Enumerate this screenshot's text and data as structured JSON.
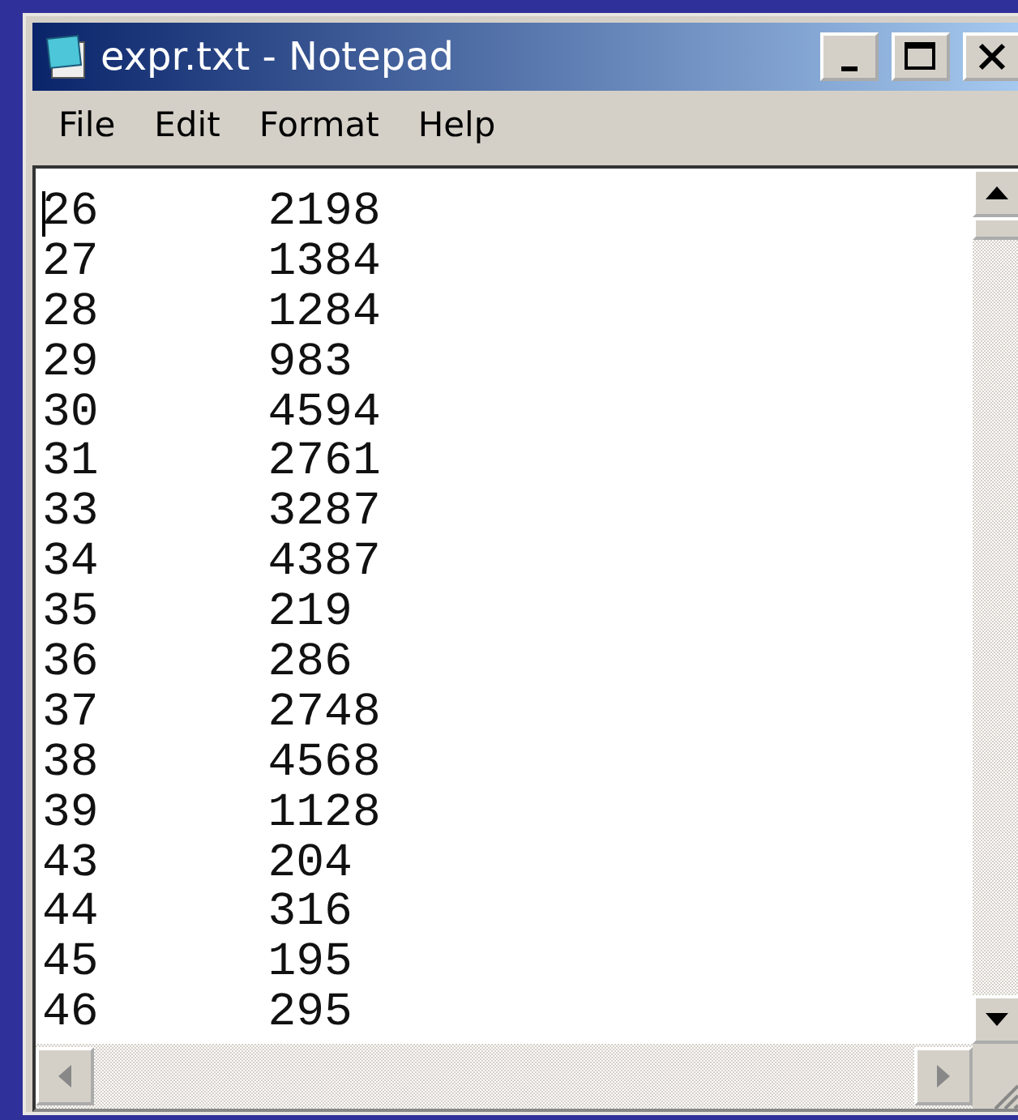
{
  "window": {
    "title": "expr.txt - Notepad"
  },
  "menu": [
    "File",
    "Edit",
    "Format",
    "Help"
  ],
  "lines": [
    "26\t2198",
    "27\t1384",
    "28\t1284",
    "29\t983",
    "30\t4594",
    "31\t2761",
    "33\t3287",
    "34\t4387",
    "35\t219",
    "36\t286",
    "37\t2748",
    "38\t4568",
    "39\t1128",
    "43\t204",
    "44\t316",
    "45\t195",
    "46\t295"
  ]
}
